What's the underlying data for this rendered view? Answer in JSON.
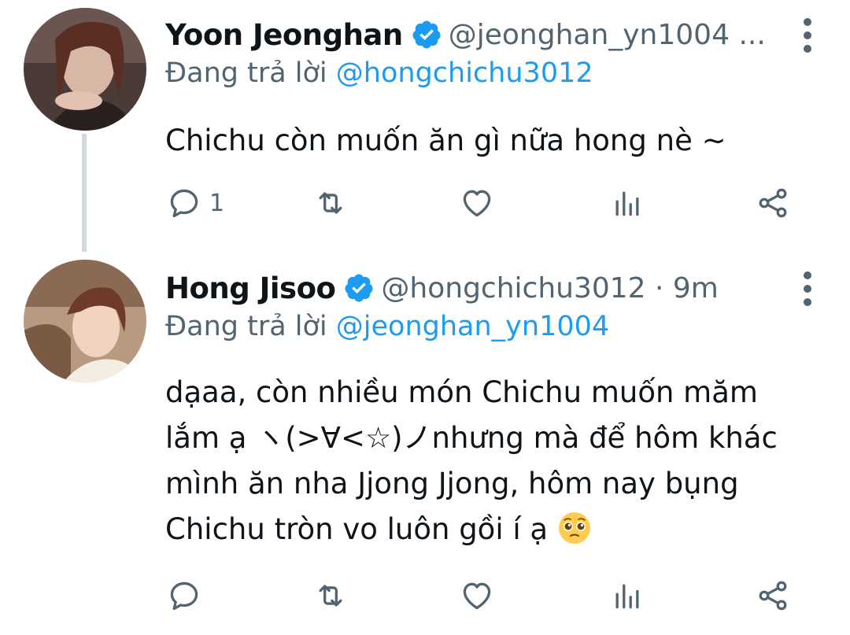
{
  "tweets": [
    {
      "author_name": "Yoon Jeonghan",
      "author_handle": "@jeonghan_yn1004 ...",
      "replying_prefix": "Đang trả lời",
      "replying_to": "@hongchichu3012",
      "text": "Chichu còn muốn ăn gì nữa hong nè ~",
      "reply_count": "1",
      "avatar_icon": "profile-photo-jeonghan"
    },
    {
      "author_name": "Hong Jisoo",
      "author_handle": "@hongchichu3012 · 9m",
      "replying_prefix": "Đang trả lời",
      "replying_to": "@jeonghan_yn1004",
      "text_lines": [
        "dạaa, còn nhiều món Chichu muốn măm",
        "lắm ạ ヽ(>∀<☆)ノnhưng mà để hôm khác",
        "mình ăn nha Jjong Jjong, hôm nay bụng",
        "Chichu tròn vo luôn gồi í ạ"
      ],
      "reply_count": "",
      "avatar_icon": "profile-photo-jisoo"
    }
  ],
  "colors": {
    "accent": "#1d9bf0",
    "secondary_text": "#536471",
    "thread_line": "#cfd9de"
  },
  "icons": [
    "verified-badge-icon",
    "more-vertical-icon",
    "reply-icon",
    "retweet-icon",
    "like-icon",
    "stats-icon",
    "share-icon",
    "pleading-face-emoji"
  ]
}
